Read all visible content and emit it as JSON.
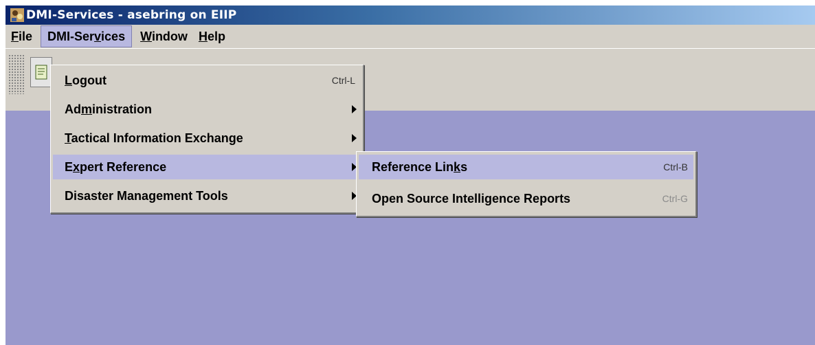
{
  "window": {
    "title": "DMI-Services - asebring on EIIP",
    "icon": "dmi-app-icon"
  },
  "menubar": {
    "items": [
      {
        "label": "File",
        "mnemonic_index": 0
      },
      {
        "label": "DMI-Services",
        "mnemonic_index": 7
      },
      {
        "label": "Window",
        "mnemonic_index": 0
      },
      {
        "label": "Help",
        "mnemonic_index": 0
      }
    ],
    "active": "DMI-Services"
  },
  "toolbar": {
    "button_icon": "document-icon"
  },
  "dropdown": {
    "items": [
      {
        "label": "Logout",
        "shortcut": "Ctrl-L",
        "submenu": false
      },
      {
        "label": "Administration",
        "shortcut": "",
        "submenu": true
      },
      {
        "label": "Tactical Information Exchange",
        "shortcut": "",
        "submenu": true
      },
      {
        "label": "Expert Reference",
        "shortcut": "",
        "submenu": true,
        "highlighted": true
      },
      {
        "label": "Disaster Management Tools",
        "shortcut": "",
        "submenu": true
      }
    ]
  },
  "submenu": {
    "items": [
      {
        "label": "Reference Links",
        "shortcut": "Ctrl-B"
      },
      {
        "label": "Open Source Intelligence Reports",
        "shortcut": "Ctrl-G",
        "shortcut_dim": true
      }
    ]
  },
  "colors": {
    "desktop": "#9999cc",
    "chrome": "#d4d0c8",
    "highlight": "#b8b8e0",
    "titlebar_start": "#0a246a",
    "titlebar_end": "#a6caf0"
  }
}
